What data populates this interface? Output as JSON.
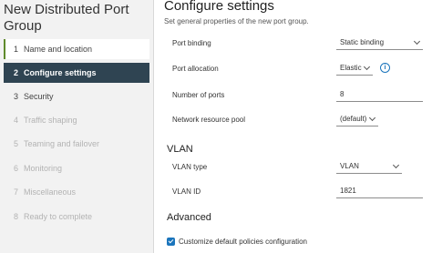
{
  "wizard": {
    "title": "New Distributed Port Group",
    "steps": [
      {
        "num": "1",
        "label": "Name and location",
        "state": "completed"
      },
      {
        "num": "2",
        "label": "Configure settings",
        "state": "active"
      },
      {
        "num": "3",
        "label": "Security",
        "state": "enabled"
      },
      {
        "num": "4",
        "label": "Traffic shaping",
        "state": "disabled"
      },
      {
        "num": "5",
        "label": "Teaming and failover",
        "state": "disabled"
      },
      {
        "num": "6",
        "label": "Monitoring",
        "state": "disabled"
      },
      {
        "num": "7",
        "label": "Miscellaneous",
        "state": "disabled"
      },
      {
        "num": "8",
        "label": "Ready to complete",
        "state": "disabled"
      }
    ]
  },
  "page": {
    "title": "Configure settings",
    "subtitle": "Set general properties of the new port group."
  },
  "fields": {
    "port_binding": {
      "label": "Port binding",
      "value": "Static binding"
    },
    "port_allocation": {
      "label": "Port allocation",
      "value": "Elastic",
      "info_icon": "info-icon"
    },
    "number_of_ports": {
      "label": "Number of ports",
      "value": "8"
    },
    "network_resource_pool": {
      "label": "Network resource pool",
      "value": "(default)"
    }
  },
  "vlan": {
    "heading": "VLAN",
    "type": {
      "label": "VLAN type",
      "value": "VLAN"
    },
    "id": {
      "label": "VLAN ID",
      "value": "1821"
    }
  },
  "advanced": {
    "heading": "Advanced",
    "customize_checkbox": {
      "label": "Customize default policies configuration",
      "checked": true
    }
  },
  "colors": {
    "accent": "#1b75bc",
    "active_step_bg": "#2f4452",
    "completed_marker": "#5f8a2c"
  }
}
